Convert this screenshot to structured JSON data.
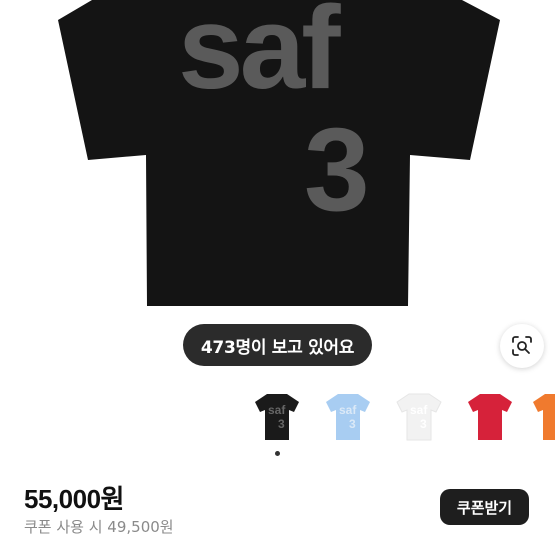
{
  "product": {
    "image_text_line1": "saf",
    "image_text_line2": "3",
    "viewers_text": "473명이 보고 있어요",
    "price": "55,000원",
    "coupon_price_text": "쿠폰 사용 시 49,500원",
    "coupon_button_label": "쿠폰받기"
  },
  "lens_icon": "lens-search-icon",
  "colors": {
    "shirt_black": "#141414",
    "print_gray": "#5a5a5a",
    "badge_bg": "#2b2b2b",
    "button_bg": "#1e1e1e",
    "variant_colors": [
      "#1a1a1a",
      "#a8cdf2",
      "#f2f2f2",
      "#d6223a",
      "#f07a2e"
    ]
  },
  "variants": [
    {
      "name": "black",
      "selected": true
    },
    {
      "name": "light-blue",
      "selected": false
    },
    {
      "name": "white",
      "selected": false
    },
    {
      "name": "red",
      "selected": false
    },
    {
      "name": "orange",
      "selected": false
    }
  ]
}
